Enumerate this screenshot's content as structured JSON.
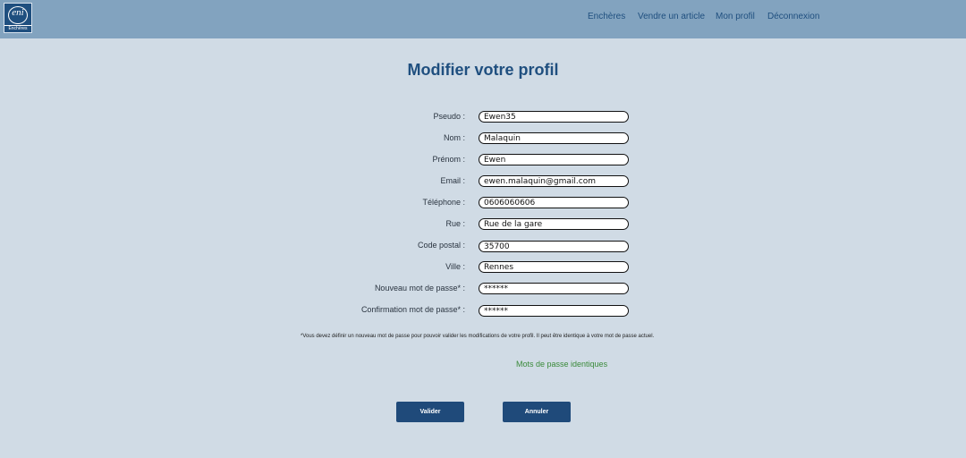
{
  "header": {
    "logo": {
      "text": "eni",
      "subtext": "Enchères"
    },
    "nav": [
      {
        "label": "Enchères"
      },
      {
        "label": "Vendre un article"
      },
      {
        "label": "Mon profil"
      },
      {
        "label": "Déconnexion"
      }
    ]
  },
  "page_title": "Modifier votre profil",
  "form": {
    "fields": [
      {
        "label": "Pseudo :",
        "value": "Ewen35",
        "type": "text"
      },
      {
        "label": "Nom :",
        "value": "Malaquin",
        "type": "text"
      },
      {
        "label": "Prénom :",
        "value": "Ewen",
        "type": "text"
      },
      {
        "label": "Email :",
        "value": "ewen.malaquin@gmail.com",
        "type": "email"
      },
      {
        "label": "Téléphone :",
        "value": "0606060606",
        "type": "text"
      },
      {
        "label": "Rue :",
        "value": "Rue de la gare",
        "type": "text"
      },
      {
        "label": "Code postal :",
        "value": "35700",
        "type": "text"
      },
      {
        "label": "Ville :",
        "value": "Rennes",
        "type": "text"
      },
      {
        "label": "Nouveau mot de passe* :",
        "value": "******",
        "type": "text"
      },
      {
        "label": "Confirmation mot de passe* :",
        "value": "******",
        "type": "text"
      }
    ],
    "note": "*Vous devez définir un nouveau mot de passe pour pouvoir valider les modifications de votre profil. Il peut être identique à votre mot de passe actuel.",
    "password_match_message": "Mots de passe identiques",
    "password_match_color": "#3a8a3a"
  },
  "buttons": {
    "submit_label": "Valider",
    "cancel_label": "Annuler"
  },
  "colors": {
    "header_bg": "#82a3bf",
    "page_bg": "#d0dbe5",
    "brand": "#1f4f7f"
  }
}
